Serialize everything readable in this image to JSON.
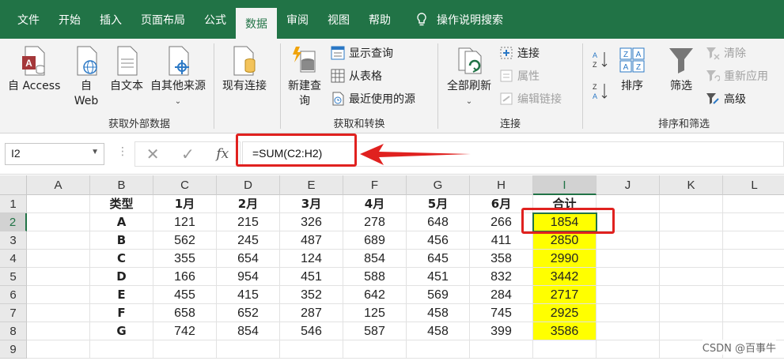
{
  "tabs": [
    "文件",
    "开始",
    "插入",
    "页面布局",
    "公式",
    "数据",
    "审阅",
    "视图",
    "帮助",
    "操作说明搜索"
  ],
  "ribbon": {
    "get_external": {
      "label": "获取外部数据",
      "buttons": [
        "自 Access",
        "自\nWeb",
        "自文本",
        "自其他来源"
      ],
      "existing": "现有连接"
    },
    "get_transform": {
      "label": "获取和转换",
      "new_query": "新建查\n询",
      "show_queries": "显示查询",
      "from_table": "从表格",
      "recent_sources": "最近使用的源"
    },
    "connections": {
      "label": "连接",
      "refresh_all": "全部刷新",
      "connections": "连接",
      "properties": "属性",
      "edit_links": "编辑链接"
    },
    "sort_filter": {
      "label": "排序和筛选",
      "sort": "排序",
      "filter": "筛选",
      "clear": "清除",
      "reapply": "重新应用",
      "advanced": "高级"
    }
  },
  "formula_bar": {
    "name_box": "I2",
    "formula": "=SUM(C2:H2)"
  },
  "columns": [
    "A",
    "B",
    "C",
    "D",
    "E",
    "F",
    "G",
    "H",
    "I",
    "J",
    "K",
    "L"
  ],
  "rows": [
    "1",
    "2",
    "3",
    "4",
    "5",
    "6",
    "7",
    "8",
    "9"
  ],
  "table": {
    "header": [
      "类型",
      "1月",
      "2月",
      "3月",
      "4月",
      "5月",
      "6月",
      "合计"
    ],
    "data": [
      [
        "A",
        "121",
        "215",
        "326",
        "278",
        "648",
        "266",
        "1854"
      ],
      [
        "B",
        "562",
        "245",
        "487",
        "689",
        "456",
        "411",
        "2850"
      ],
      [
        "C",
        "355",
        "654",
        "124",
        "854",
        "645",
        "358",
        "2990"
      ],
      [
        "D",
        "166",
        "954",
        "451",
        "588",
        "451",
        "832",
        "3442"
      ],
      [
        "E",
        "455",
        "415",
        "352",
        "642",
        "569",
        "284",
        "2717"
      ],
      [
        "F",
        "658",
        "652",
        "287",
        "125",
        "458",
        "745",
        "2925"
      ],
      [
        "G",
        "742",
        "854",
        "546",
        "587",
        "458",
        "399",
        "3586"
      ]
    ]
  },
  "watermark": "CSDN @百事牛",
  "colors": {
    "accent": "#217346",
    "highlight": "#ffff00",
    "annotation": "#e0211f"
  }
}
